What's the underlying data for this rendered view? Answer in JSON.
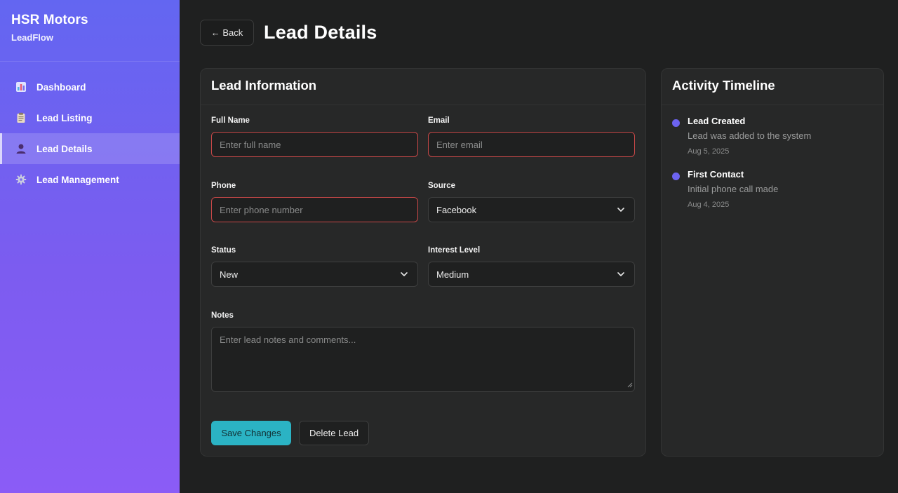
{
  "brand": {
    "title": "HSR Motors",
    "subtitle": "LeadFlow"
  },
  "sidebar": {
    "items": [
      {
        "label": "Dashboard",
        "icon": "bar-chart-icon",
        "active": false
      },
      {
        "label": "Lead Listing",
        "icon": "clipboard-icon",
        "active": false
      },
      {
        "label": "Lead Details",
        "icon": "user-icon",
        "active": true
      },
      {
        "label": "Lead Management",
        "icon": "gear-icon",
        "active": false
      }
    ]
  },
  "header": {
    "back_label": "← Back",
    "title": "Lead Details"
  },
  "lead_info": {
    "title": "Lead Information",
    "full_name": {
      "label": "Full Name",
      "placeholder": "Enter full name"
    },
    "email": {
      "label": "Email",
      "placeholder": "Enter email"
    },
    "phone": {
      "label": "Phone",
      "placeholder": "Enter phone number"
    },
    "source": {
      "label": "Source",
      "value": "Facebook"
    },
    "status": {
      "label": "Status",
      "value": "New"
    },
    "interest": {
      "label": "Interest Level",
      "value": "Medium"
    },
    "notes": {
      "label": "Notes",
      "placeholder": "Enter lead notes and comments..."
    },
    "save_label": "Save Changes",
    "delete_label": "Delete Lead"
  },
  "timeline": {
    "title": "Activity Timeline",
    "items": [
      {
        "title": "Lead Created",
        "desc": "Lead was added to the system",
        "date": "Aug 5, 2025"
      },
      {
        "title": "First Contact",
        "desc": "Initial phone call made",
        "date": "Aug 4, 2025"
      }
    ]
  },
  "colors": {
    "sidebar_top": "#6366f1",
    "sidebar_bottom": "#8b5cf6",
    "accent_save": "#2bb3c4",
    "error_border": "#c74848",
    "timeline_dot": "#6c63f0"
  }
}
